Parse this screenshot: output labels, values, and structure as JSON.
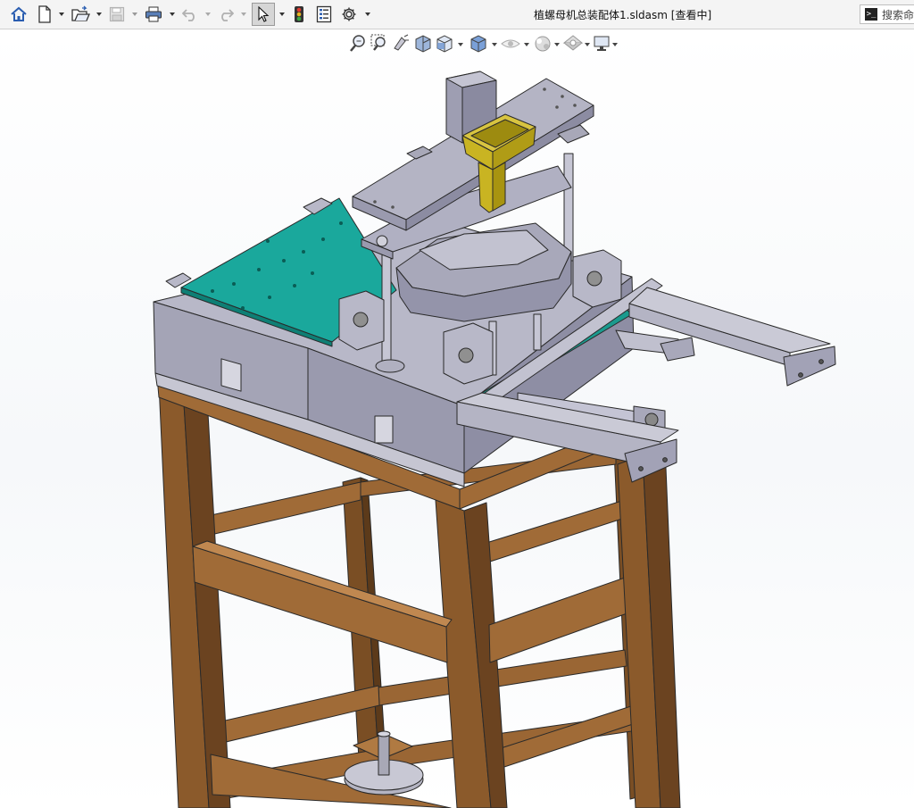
{
  "window": {
    "title": "植螺母机总装配体1.sldasm [查看中]"
  },
  "toolbar": {
    "items": [
      "home-icon",
      "new-document-icon",
      "open-folder-icon",
      "save-icon",
      "print-icon",
      "undo-icon",
      "redo-icon",
      "select-arrow-icon",
      "traffic-light-icon",
      "file-properties-icon",
      "options-gear-icon"
    ]
  },
  "search": {
    "placeholder": "搜索命令",
    "icon": "command-prompt-icon"
  },
  "view_toolbar": {
    "items": [
      "zoom-to-fit-icon",
      "zoom-to-area-icon",
      "previous-view-icon",
      "section-view-icon",
      "view-orientation-icon",
      "display-style-icon",
      "hide-show-items-icon",
      "edit-appearance-icon",
      "apply-scene-icon",
      "view-settings-icon"
    ]
  },
  "colors": {
    "frame_wood": "#8b5a2b",
    "steel": "#a6a6b8",
    "plate_teal": "#1aa89c",
    "hopper_yellow": "#c9b422",
    "edge": "#2a2a2a"
  }
}
